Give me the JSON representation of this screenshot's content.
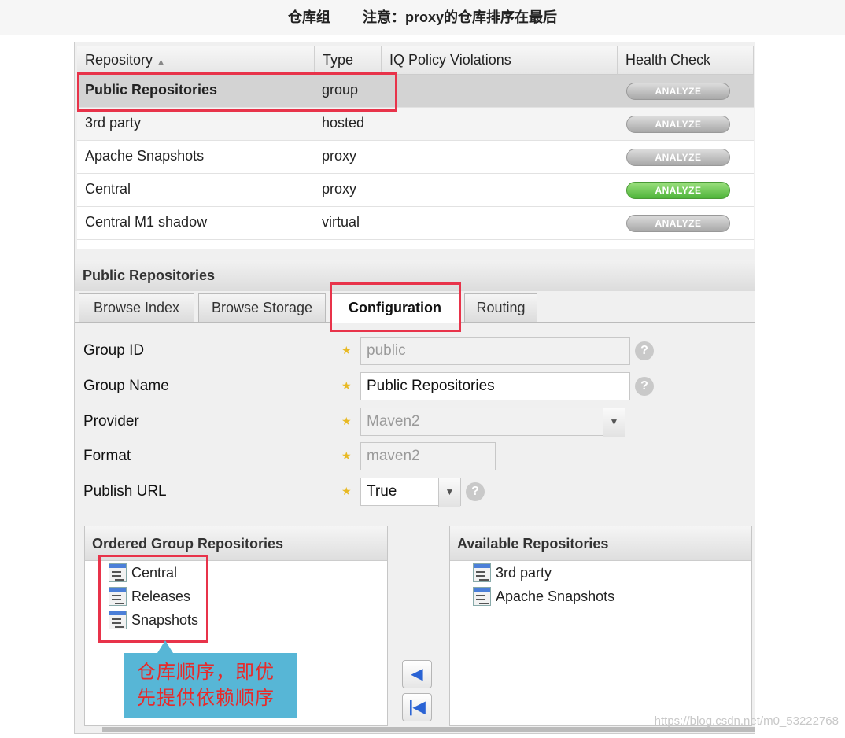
{
  "header": {
    "title": "仓库组",
    "note": "注意：proxy的仓库排序在最后"
  },
  "table": {
    "columns": [
      "Repository",
      "Type",
      "IQ Policy Violations",
      "Health Check"
    ],
    "sort_icon": "sort-asc-icon",
    "rows": [
      {
        "name": "Public Repositories",
        "type": "group",
        "action": "ANALYZE",
        "selected": true
      },
      {
        "name": "3rd party",
        "type": "hosted",
        "action": "ANALYZE"
      },
      {
        "name": "Apache Snapshots",
        "type": "proxy",
        "action": "ANALYZE"
      },
      {
        "name": "Central",
        "type": "proxy",
        "action": "ANALYZE",
        "status_color": "#5cc043"
      },
      {
        "name": "Central M1 shadow",
        "type": "virtual",
        "action": "ANALYZE"
      }
    ]
  },
  "detail": {
    "title": "Public Repositories",
    "tabs": [
      "Browse Index",
      "Browse Storage",
      "Configuration",
      "Routing"
    ],
    "active_tab": "Configuration",
    "form": {
      "group_id": {
        "label": "Group ID",
        "value": "public"
      },
      "group_name": {
        "label": "Group Name",
        "value": "Public Repositories"
      },
      "provider": {
        "label": "Provider",
        "value": "Maven2"
      },
      "format": {
        "label": "Format",
        "value": "maven2"
      },
      "publish_url": {
        "label": "Publish URL",
        "value": "True"
      }
    },
    "ordered": {
      "title": "Ordered Group Repositories",
      "items": [
        "Central",
        "Releases",
        "Snapshots"
      ]
    },
    "available": {
      "title": "Available Repositories",
      "items": [
        "3rd party",
        "Apache Snapshots"
      ]
    },
    "callout": [
      "仓库顺序，即优",
      "先提供依赖顺序"
    ]
  },
  "watermark": "https://blog.csdn.net/m0_53222768"
}
